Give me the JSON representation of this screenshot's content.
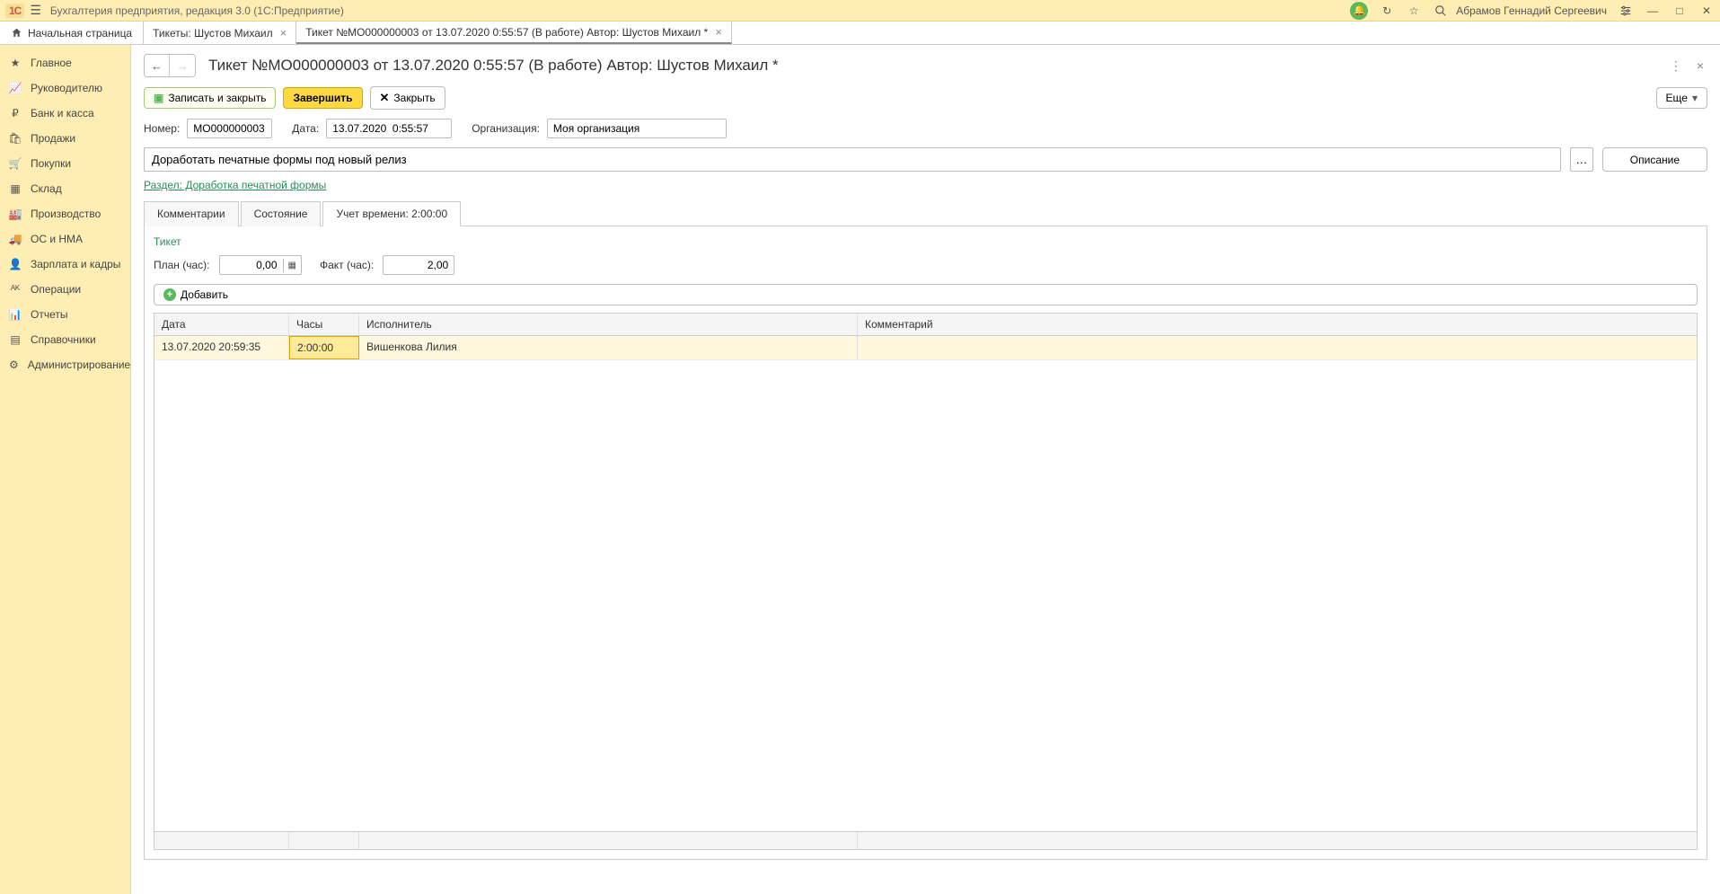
{
  "app": {
    "logo": "1C",
    "title": "Бухгалтерия предприятия, редакция 3.0  (1С:Предприятие)",
    "user": "Абрамов Геннадий Сергеевич"
  },
  "tabs": {
    "home": "Начальная страница",
    "items": [
      {
        "label": "Тикеты: Шустов Михаил",
        "active": false
      },
      {
        "label": "Тикет №МО000000003 от 13.07.2020 0:55:57 (В работе) Автор: Шустов Михаил *",
        "active": true
      }
    ]
  },
  "sidebar": [
    {
      "icon": "star",
      "label": "Главное"
    },
    {
      "icon": "chart",
      "label": "Руководителю"
    },
    {
      "icon": "bank",
      "label": "Банк и касса"
    },
    {
      "icon": "cart",
      "label": "Продажи"
    },
    {
      "icon": "basket",
      "label": "Покупки"
    },
    {
      "icon": "boxes",
      "label": "Склад"
    },
    {
      "icon": "factory",
      "label": "Производство"
    },
    {
      "icon": "truck",
      "label": "ОС и НМА"
    },
    {
      "icon": "person",
      "label": "Зарплата и кадры"
    },
    {
      "icon": "ops",
      "label": "Операции"
    },
    {
      "icon": "report",
      "label": "Отчеты"
    },
    {
      "icon": "book",
      "label": "Справочники"
    },
    {
      "icon": "gear",
      "label": "Администрирование"
    }
  ],
  "page": {
    "title": "Тикет №МО000000003 от 13.07.2020 0:55:57 (В работе) Автор: Шустов Михаил *"
  },
  "toolbar": {
    "save_close": "Записать и закрыть",
    "finish": "Завершить",
    "close": "Закрыть",
    "more": "Еще"
  },
  "form": {
    "number_label": "Номер:",
    "number_value": "МО000000003",
    "date_label": "Дата:",
    "date_value": "13.07.2020  0:55:57",
    "org_label": "Организация:",
    "org_value": "Моя организация",
    "subject": "Доработать печатные формы под новый релиз",
    "description_btn": "Описание",
    "section_link": "Раздел: Доработка печатной формы"
  },
  "innertabs": [
    {
      "label": "Комментарии",
      "active": false
    },
    {
      "label": "Состояние",
      "active": false
    },
    {
      "label": "Учет времени: 2:00:00",
      "active": true
    }
  ],
  "timetracking": {
    "ticket_link": "Тикет",
    "plan_label": "План (час):",
    "plan_value": "0,00",
    "fact_label": "Факт (час):",
    "fact_value": "2,00",
    "add_btn": "Добавить",
    "columns": [
      "Дата",
      "Часы",
      "Исполнитель",
      "Комментарий"
    ],
    "rows": [
      {
        "date": "13.07.2020 20:59:35",
        "hours": "2:00:00",
        "person": "Вишенкова Лилия",
        "comment": ""
      }
    ]
  }
}
